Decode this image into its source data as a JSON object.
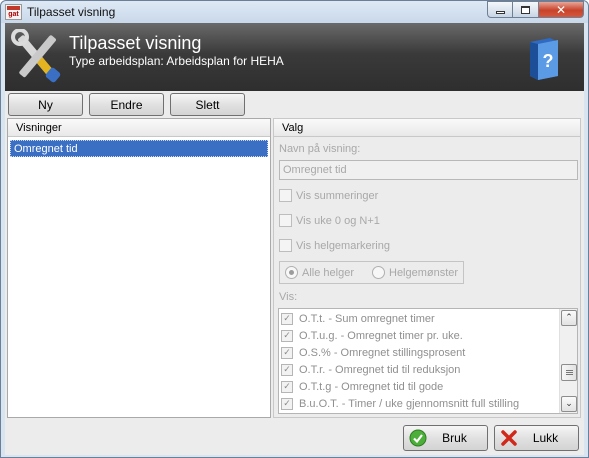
{
  "window": {
    "title": "Tilpasset visning"
  },
  "header": {
    "title": "Tilpasset visning",
    "subtitle": "Type arbeidsplan: Arbeidsplan for HEHA"
  },
  "toolbar": {
    "new_label": "Ny",
    "edit_label": "Endre",
    "delete_label": "Slett"
  },
  "left_panel": {
    "header": "Visninger",
    "items": [
      {
        "label": "Omregnet tid",
        "selected": true
      }
    ]
  },
  "right_panel": {
    "header": "Valg",
    "name_label": "Navn på visning:",
    "name_value": "Omregnet tid",
    "checkboxes": [
      {
        "label": "Vis summeringer",
        "checked": false
      },
      {
        "label": "Vis uke 0 og  N+1",
        "checked": false
      },
      {
        "label": "Vis helgemarkering",
        "checked": false
      }
    ],
    "radios": [
      {
        "label": "Alle helger",
        "selected": true
      },
      {
        "label": "Helgemønster",
        "selected": false
      }
    ],
    "vis_label": "Vis:",
    "vis_items": [
      {
        "label": "O.T.t. - Sum omregnet timer",
        "checked": true
      },
      {
        "label": "O.T.u.g. - Omregnet timer pr. uke.",
        "checked": true
      },
      {
        "label": "O.S.% - Omregnet stillingsprosent",
        "checked": true
      },
      {
        "label": "O.T.r. - Omregnet tid til reduksjon",
        "checked": true
      },
      {
        "label": "O.T.t.g - Omregnet tid til gode",
        "checked": true
      },
      {
        "label": "B.u.O.T. - Timer / uke gjennomsnitt full stilling",
        "checked": true
      }
    ]
  },
  "footer": {
    "apply_label": "Bruk",
    "close_label": "Lukk"
  },
  "colors": {
    "header_bg": "#3a3a3a",
    "selection": "#3a6fc4",
    "close_red": "#c7432a"
  }
}
